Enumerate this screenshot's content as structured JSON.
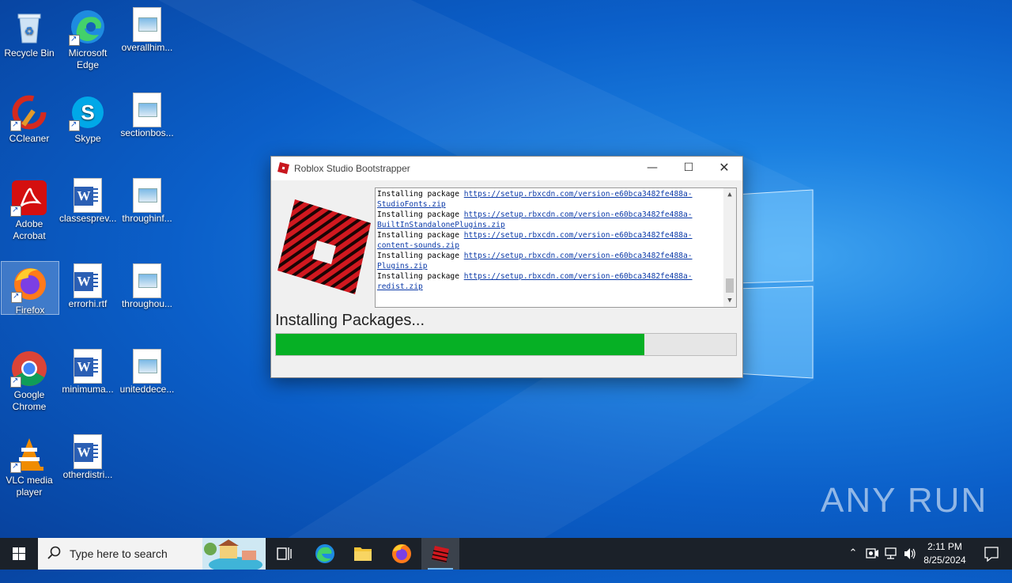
{
  "desktop": {
    "icons": [
      {
        "label": "Recycle Bin"
      },
      {
        "label": "Microsoft Edge"
      },
      {
        "label": "overallhim..."
      },
      {
        "label": "CCleaner"
      },
      {
        "label": "Skype"
      },
      {
        "label": "sectionbos..."
      },
      {
        "label": "Adobe Acrobat"
      },
      {
        "label": "classesprev..."
      },
      {
        "label": "throughinf..."
      },
      {
        "label": "Firefox"
      },
      {
        "label": "errorhi.rtf"
      },
      {
        "label": "throughou..."
      },
      {
        "label": "Google Chrome"
      },
      {
        "label": "minimuma..."
      },
      {
        "label": "uniteddece..."
      },
      {
        "label": "VLC media player"
      },
      {
        "label": "otherdistri..."
      }
    ]
  },
  "dialog": {
    "title": "Roblox Studio Bootstrapper",
    "log": [
      {
        "prefix": "Installing package ",
        "link1": "https://setup.rbxcdn.com/version-e60bca3482fe488a-",
        "link2": "StudioFonts.zip"
      },
      {
        "prefix": "Installing package ",
        "link1": "https://setup.rbxcdn.com/version-e60bca3482fe488a-",
        "link2": "BuiltInStandalonePlugins.zip"
      },
      {
        "prefix": "Installing package ",
        "link1": "https://setup.rbxcdn.com/version-e60bca3482fe488a-",
        "link2": "content-sounds.zip"
      },
      {
        "prefix": "Installing package ",
        "link1": "https://setup.rbxcdn.com/version-e60bca3482fe488a-",
        "link2": "Plugins.zip"
      },
      {
        "prefix": "Installing package ",
        "link1": "https://setup.rbxcdn.com/version-e60bca3482fe488a-",
        "link2": "redist.zip"
      }
    ],
    "status": "Installing Packages...",
    "progress_percent": 80
  },
  "taskbar": {
    "search_placeholder": "Type here to search",
    "time": "2:11 PM",
    "date": "8/25/2024"
  },
  "watermark": "ANY RUN",
  "colors": {
    "progress": "#06b025",
    "roblox_red": "#d0181f"
  }
}
